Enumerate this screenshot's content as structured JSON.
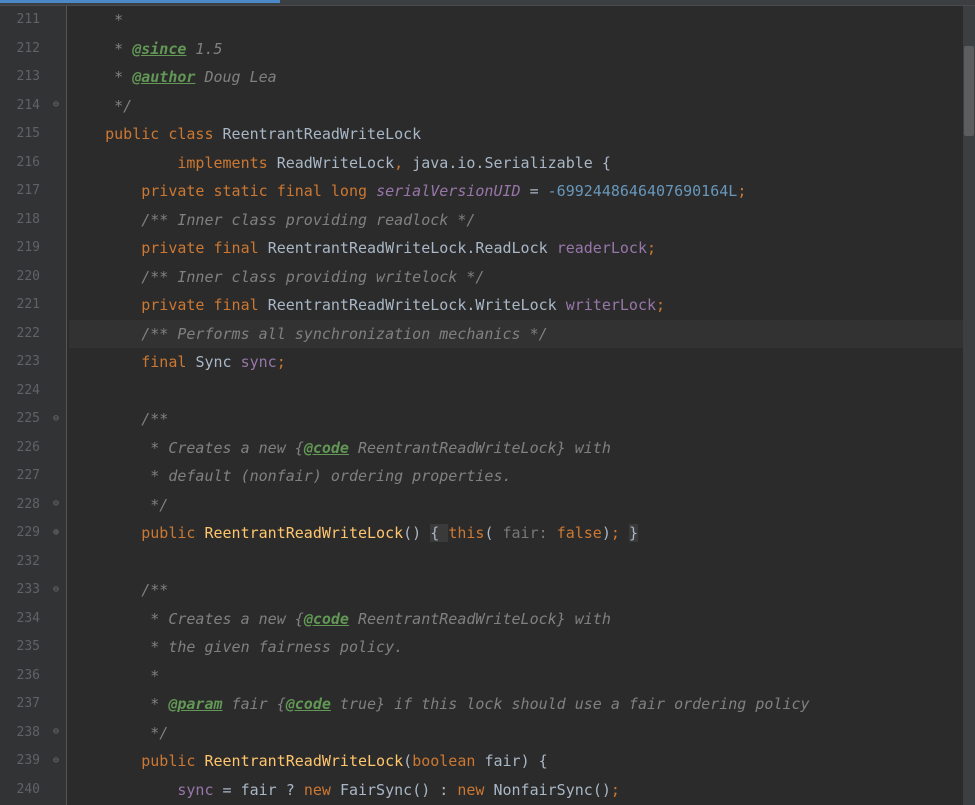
{
  "gutter": [
    "211",
    "212",
    "213",
    "214",
    "215",
    "216",
    "217",
    "218",
    "219",
    "220",
    "221",
    "222",
    "223",
    "224",
    "225",
    "226",
    "227",
    "228",
    "229",
    "232",
    "233",
    "234",
    "235",
    "236",
    "237",
    "238",
    "239",
    "240"
  ],
  "fold": {
    "l214": "⊖",
    "l225": "⊖",
    "l228": "⊖",
    "l229": "⊕",
    "l233": "⊖",
    "l237_top": "◡",
    "l238": "⊖",
    "l239": "⊖"
  },
  "code": {
    "l211": " *",
    "l212_pre": " * ",
    "l212_tag": "@since",
    "l212_post": " 1.5",
    "l213_pre": " * ",
    "l213_tag": "@author",
    "l213_post": " Doug Lea",
    "l214": " */",
    "l215_kw1": "public ",
    "l215_kw2": "class ",
    "l215_name": "ReentrantReadWriteLock",
    "l216_kw": "implements ",
    "l216_t1": "ReadWriteLock",
    "l216_c1": ", ",
    "l216_t2": "java",
    "l216_d1": ".",
    "l216_t3": "io",
    "l216_d2": ".",
    "l216_t4": "Serializable ",
    "l216_b": "{",
    "l217_kw1": "private ",
    "l217_kw2": "static ",
    "l217_kw3": "final ",
    "l217_kw4": "long ",
    "l217_f": "serialVersionUID",
    "l217_eq": " = ",
    "l217_n": "-6992448646407690164L",
    "l217_s": ";",
    "l218": "/** Inner class providing readlock */",
    "l219_kw1": "private ",
    "l219_kw2": "final ",
    "l219_t1": "ReentrantReadWriteLock",
    "l219_d": ".",
    "l219_t2": "ReadLock ",
    "l219_f": "readerLock",
    "l219_s": ";",
    "l220": "/** Inner class providing writelock */",
    "l221_kw1": "private ",
    "l221_kw2": "final ",
    "l221_t1": "ReentrantReadWriteLock",
    "l221_d": ".",
    "l221_t2": "WriteLock ",
    "l221_f": "writerLock",
    "l221_s": ";",
    "l222": "/** Performs all synchronization mechanics */",
    "l223_kw": "final ",
    "l223_t": "Sync ",
    "l223_f": "sync",
    "l223_s": ";",
    "l225": "/**",
    "l226_pre": " * Creates a new {",
    "l226_tag": "@code",
    "l226_post": " ReentrantReadWriteLock} with",
    "l227": " * default (nonfair) ordering properties.",
    "l228": " */",
    "l229_kw": "public ",
    "l229_m": "ReentrantReadWriteLock",
    "l229_p1": "() ",
    "l229_b1": "{ ",
    "l229_this": "this",
    "l229_p2": "(",
    "l229_hint": " fair: ",
    "l229_false": "false",
    "l229_p3": ")",
    "l229_s": "; ",
    "l229_b2": "}",
    "l233": "/**",
    "l234_pre": " * Creates a new {",
    "l234_tag": "@code",
    "l234_post": " ReentrantReadWriteLock} with",
    "l235": " * the given fairness policy.",
    "l236": " *",
    "l237_pre": " * ",
    "l237_tag": "@param",
    "l237_mid": " fair {",
    "l237_tag2": "@code",
    "l237_post": " true} if this lock should use a fair ordering policy",
    "l238": " */",
    "l239_kw": "public ",
    "l239_m": "ReentrantReadWriteLock",
    "l239_p1": "(",
    "l239_bool": "boolean ",
    "l239_param": "fair",
    "l239_p2": ") {",
    "l240_f": "sync",
    "l240_eq": " = ",
    "l240_p": "fair ",
    "l240_q": "? ",
    "l240_new1": "new ",
    "l240_t1": "FairSync",
    "l240_p1": "() : ",
    "l240_new2": "new ",
    "l240_t2": "NonfairSync",
    "l240_p2": "()",
    "l240_s": ";"
  }
}
